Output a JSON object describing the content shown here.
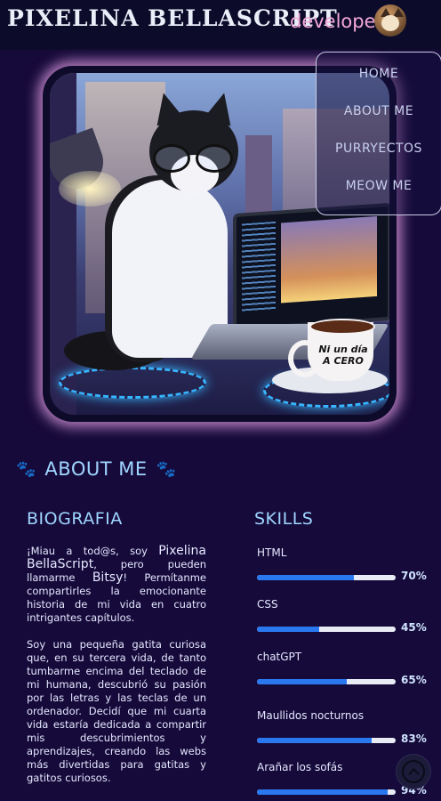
{
  "header": {
    "brand": "PIXELINA BELLASCRIPT",
    "role": "developer",
    "avatar_icon": "cat-avatar"
  },
  "hero": {
    "mug_text": "Ni un día A CERO"
  },
  "nav": {
    "items": [
      {
        "label": "HOME"
      },
      {
        "label": "ABOUT ME"
      },
      {
        "label": "PURRYECTOS"
      },
      {
        "label": "MEOW ME"
      }
    ]
  },
  "about": {
    "title": "ABOUT ME",
    "paw_glyph": "🐾",
    "bio_title": "BIOGRAFIA",
    "skills_title": "SKILLS",
    "bio": {
      "p1_a": "¡Miau a tod@s, soy ",
      "p1_name": "Pixelina BellaScript",
      "p1_b": ", pero pueden llamarme ",
      "p1_nick": "Bitsy",
      "p1_c": "! Permítanme compartirles la emocionante historia de mi vida en cuatro intrigantes capítulos.",
      "p2": "Soy una pequeña gatita curiosa que, en su tercera vida, de tanto tumbarme encima del teclado de mi humana, descubrió su pasión por las letras y las teclas de un ordenador. Decidí que mi cuarta vida estaría dedicada a compartir mis descubrimientos y aprendizajes, creando las webs más divertidas para gatitas y gatitos curiosos."
    },
    "skills": [
      {
        "name": "HTML",
        "percent_label": "70%",
        "level": 0.7
      },
      {
        "name": "CSS",
        "percent_label": "45%",
        "level": 0.45
      },
      {
        "name": "chatGPT",
        "percent_label": "65%",
        "level": 0.65
      },
      {
        "name": "Maullidos nocturnos",
        "percent_label": "83%",
        "level": 0.83
      },
      {
        "name": "Arañar los sofás",
        "percent_label": "94%",
        "level": 0.94
      }
    ]
  },
  "colors": {
    "accent": "#9fd6ff",
    "role": "#f2a8d8",
    "bar_fill": "#2a78f0",
    "background": "#160a3a"
  },
  "back_to_top_icon": "chevron-up-icon"
}
